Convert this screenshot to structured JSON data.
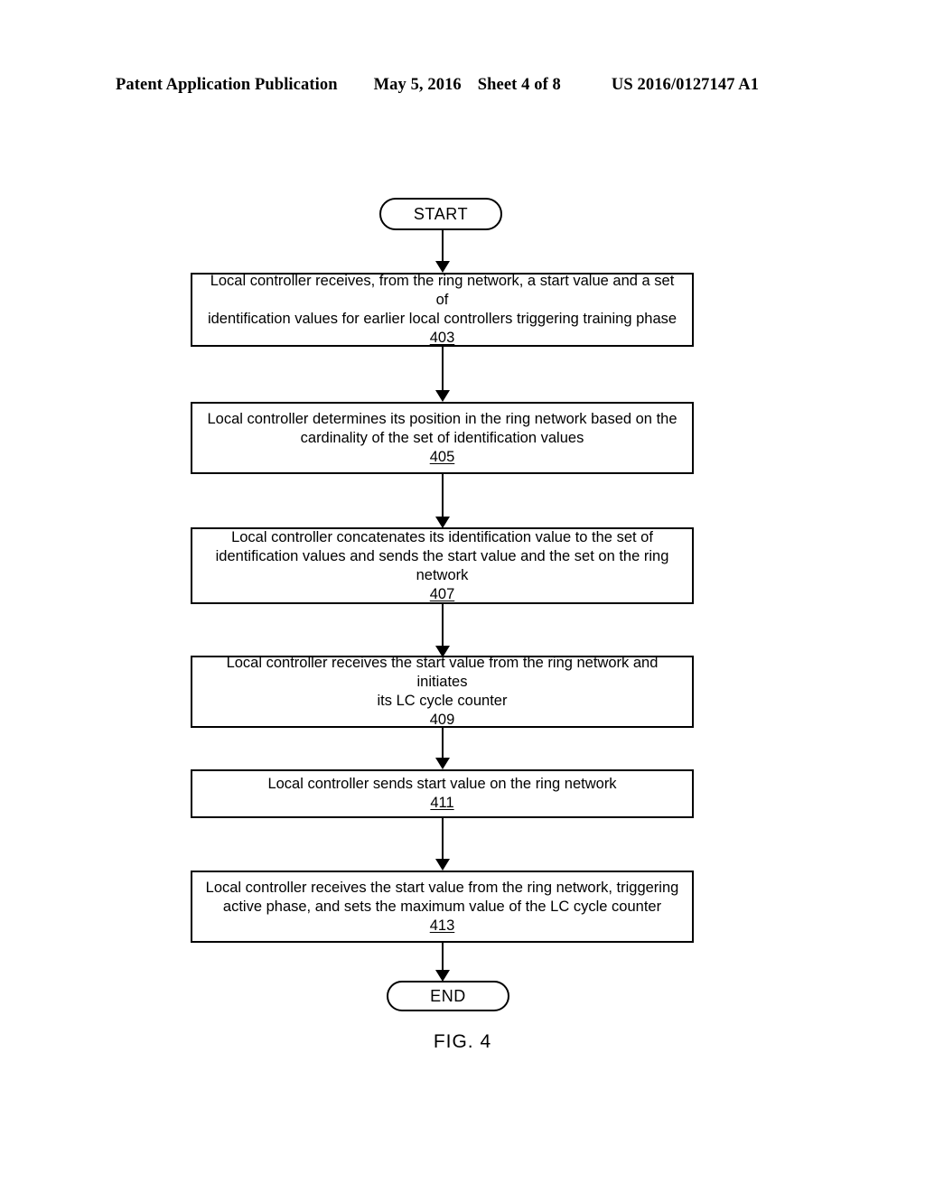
{
  "header": {
    "publication": "Patent Application Publication",
    "date": "May 5, 2016",
    "sheet": "Sheet 4 of 8",
    "patent_number": "US 2016/0127147 A1"
  },
  "figure": {
    "caption": "FIG. 4",
    "start_label": "START",
    "end_label": "END"
  },
  "steps": [
    {
      "ref": "403",
      "text": "Local controller receives, from the ring network, a start value and a set of\nidentification values for earlier local controllers triggering training phase"
    },
    {
      "ref": "405",
      "text": "Local controller determines its position in the ring network based on the\ncardinality of the set of identification values"
    },
    {
      "ref": "407",
      "text": "Local controller concatenates its identification value to the set of\nidentification values and sends the start value and the set on the ring\nnetwork"
    },
    {
      "ref": "409",
      "text": "Local controller receives the start value from the ring network and initiates\nits LC cycle counter"
    },
    {
      "ref": "411",
      "text": "Local controller sends start value on the ring network"
    },
    {
      "ref": "413",
      "text": "Local controller receives the start value from the ring network, triggering\nactive phase, and sets the maximum value of the LC cycle counter"
    }
  ]
}
